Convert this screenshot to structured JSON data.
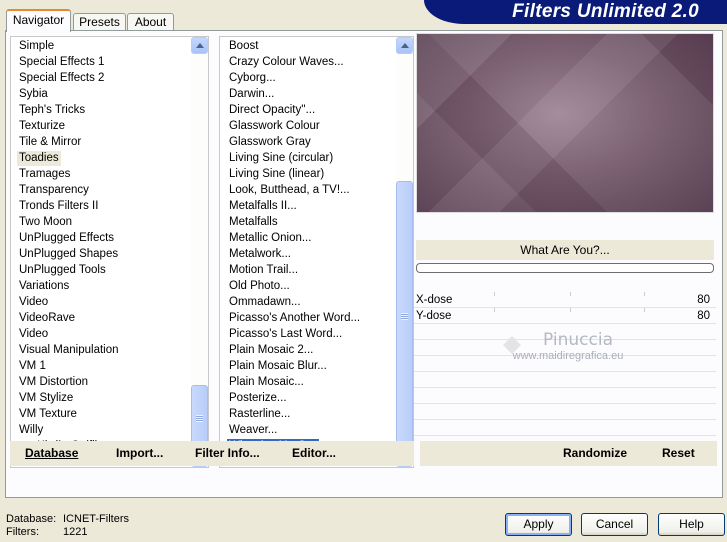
{
  "app": {
    "title": "Filters Unlimited 2.0"
  },
  "tabs": [
    {
      "label": "Navigator",
      "active": true
    },
    {
      "label": "Presets",
      "active": false
    },
    {
      "label": "About",
      "active": false
    }
  ],
  "categories": {
    "items": [
      "Simple",
      "Special Effects 1",
      "Special Effects 2",
      "Sybia",
      "Teph's Tricks",
      "Texturize",
      "Tile & Mirror",
      "Toadies",
      "Tramages",
      "Transparency",
      "Tronds Filters II",
      "Two Moon",
      "UnPlugged Effects",
      "UnPlugged Shapes",
      "UnPlugged Tools",
      "Variations",
      "Video",
      "VideoRave",
      "Video",
      "Visual Manipulation",
      "VM 1",
      "VM Distortion",
      "VM Stylize",
      "VM Texture",
      "Willy",
      "°v° Kiwi`s Oelfilter"
    ],
    "highlighted": "Toadies",
    "scroll_fraction": 0.95
  },
  "filters": {
    "items": [
      "Boost",
      "Crazy Colour Waves...",
      "Cyborg...",
      "Darwin...",
      "Direct Opacity''...",
      "Glasswork Colour",
      "Glasswork Gray",
      "Living Sine (circular)",
      "Living Sine (linear)",
      "Look, Butthead, a TV!...",
      "Metalfalls II...",
      "Metalfalls",
      "Metallic Onion...",
      "Metalwork...",
      "Motion Trail...",
      "Old Photo...",
      "Ommadawn...",
      "Picasso's Another Word...",
      "Picasso's Last Word...",
      "Plain Mosaic 2...",
      "Plain Mosaic Blur...",
      "Plain Mosaic...",
      "Posterize...",
      "Rasterline...",
      "Weaver...",
      "What Are You?..."
    ],
    "selected": "What Are You?...",
    "scroll_fraction": 1.0
  },
  "preview": {
    "filter_name": "What Are You?...",
    "progress": 0
  },
  "params": [
    {
      "label": "X-dose",
      "value": "80"
    },
    {
      "label": "Y-dose",
      "value": "80"
    }
  ],
  "watermark": {
    "line1": "Pinuccia",
    "line2": "www.maidiregrafica.eu"
  },
  "links": {
    "database": "Database",
    "import": "Import...",
    "filter_info": "Filter Info...",
    "editor": "Editor...",
    "randomize": "Randomize",
    "reset": "Reset"
  },
  "status": {
    "database_label": "Database:",
    "database_value": "ICNET-Filters",
    "filters_label": "Filters:",
    "filters_value": "1221"
  },
  "buttons": {
    "apply": "Apply",
    "cancel": "Cancel",
    "help": "Help"
  },
  "colors": {
    "banner": "#0a1a78",
    "selection": "#316ac5",
    "dialog_bg": "#ece9d8"
  }
}
